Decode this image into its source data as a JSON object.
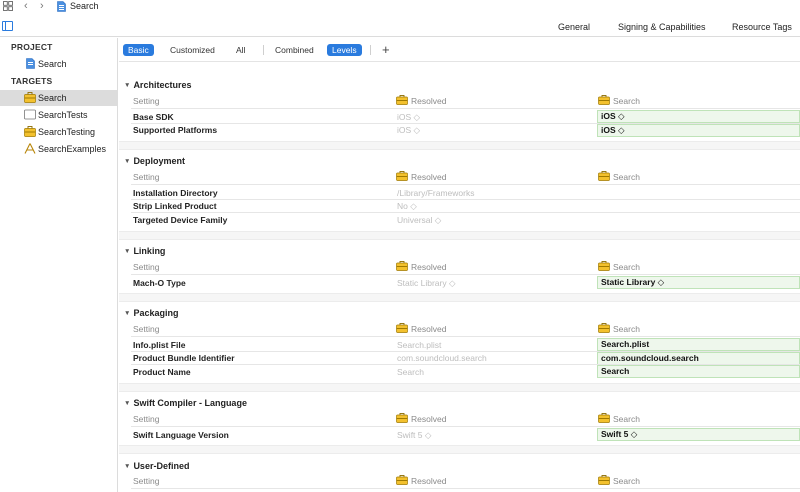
{
  "topbar": {
    "breadcrumb": "Search",
    "back": "‹",
    "forward": "›"
  },
  "editor_tabs": [
    "General",
    "Signing & Capabilities",
    "Resource Tags"
  ],
  "sidebar": {
    "project_header": "PROJECT",
    "project_item": "Search",
    "targets_header": "TARGETS",
    "targets": [
      "Search",
      "SearchTests",
      "SearchTesting",
      "SearchExamples"
    ]
  },
  "filters": {
    "basic": "Basic",
    "customized": "Customized",
    "all": "All",
    "combined": "Combined",
    "levels": "Levels",
    "add": "+"
  },
  "columns": {
    "setting": "Setting",
    "resolved": "Resolved",
    "target": "Search"
  },
  "sections": [
    {
      "title": "Architectures",
      "rows": [
        {
          "name": "Base SDK",
          "resolved": "iOS ◇",
          "value": "iOS ◇"
        },
        {
          "name": "Supported Platforms",
          "resolved": "iOS ◇",
          "value": "iOS ◇"
        }
      ]
    },
    {
      "title": "Deployment",
      "rows": [
        {
          "name": "Installation Directory",
          "resolved": "/Library/Frameworks",
          "value": ""
        },
        {
          "name": "Strip Linked Product",
          "resolved": "No ◇",
          "value": ""
        },
        {
          "name": "Targeted Device Family",
          "resolved": "Universal ◇",
          "value": ""
        }
      ]
    },
    {
      "title": "Linking",
      "rows": [
        {
          "name": "Mach-O Type",
          "resolved": "Static Library ◇",
          "value": "Static Library ◇"
        }
      ]
    },
    {
      "title": "Packaging",
      "rows": [
        {
          "name": "Info.plist File",
          "resolved": "Search.plist",
          "value": "Search.plist"
        },
        {
          "name": "Product Bundle Identifier",
          "resolved": "com.soundcloud.search",
          "value": "com.soundcloud.search"
        },
        {
          "name": "Product Name",
          "resolved": "Search",
          "value": "Search"
        }
      ]
    },
    {
      "title": "Swift Compiler - Language",
      "rows": [
        {
          "name": "Swift Language Version",
          "resolved": "Swift 5 ◇",
          "value": "Swift 5 ◇"
        }
      ]
    },
    {
      "title": "User-Defined",
      "rows": []
    }
  ]
}
